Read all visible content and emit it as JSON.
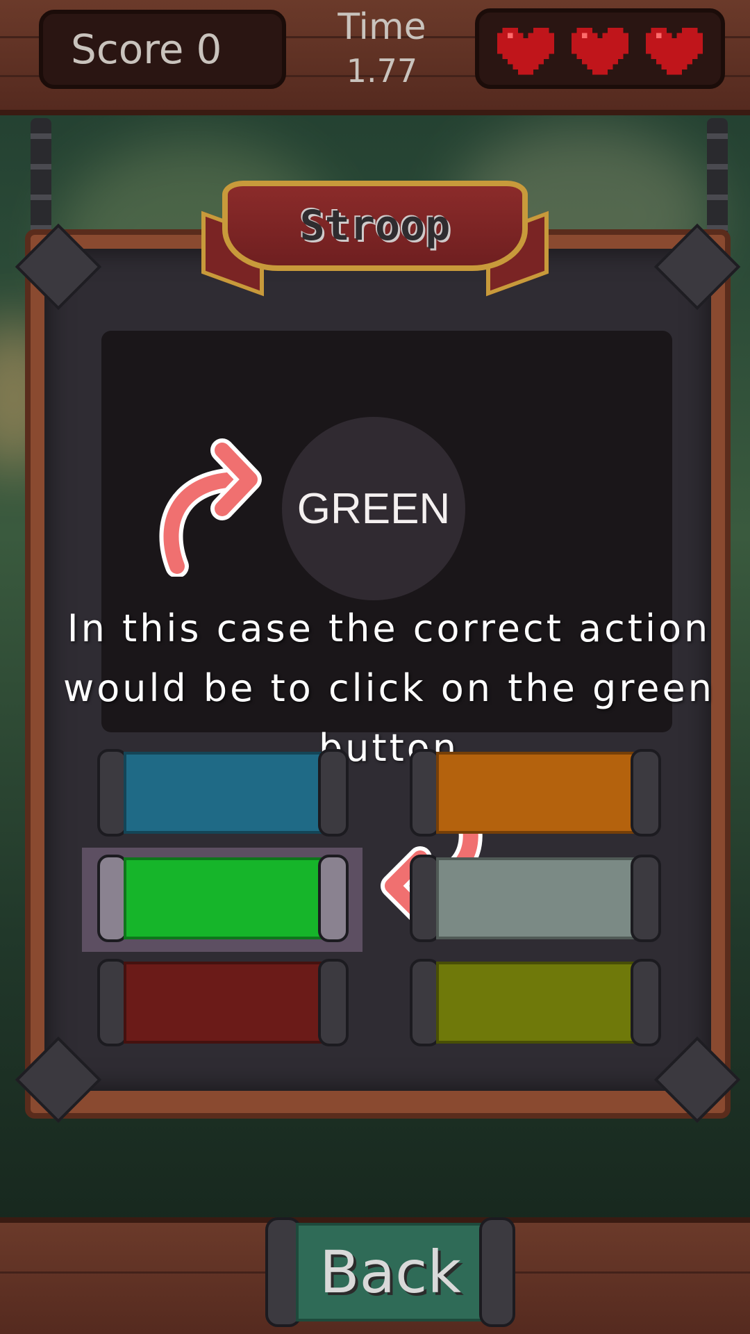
{
  "hud": {
    "score_label": "Score",
    "score_value": "0",
    "time_label": "Time",
    "time_value": "1.77",
    "lives": 3,
    "heart_color": "#c0151b"
  },
  "panel": {
    "title": "Stroop"
  },
  "stimulus": {
    "word": "GREEN"
  },
  "tutorial": {
    "hint_text": "In this case the correct action would be to click on the green button"
  },
  "color_buttons": [
    {
      "name": "blue",
      "color": "#1f6a86"
    },
    {
      "name": "orange",
      "color": "#b4620d"
    },
    {
      "name": "green",
      "color": "#16b52a",
      "highlighted": true
    },
    {
      "name": "gray",
      "color": "#7b8a85"
    },
    {
      "name": "red",
      "color": "#6b1b18"
    },
    {
      "name": "yellow",
      "color": "#6f790a"
    }
  ],
  "footer": {
    "back_label": "Back"
  }
}
